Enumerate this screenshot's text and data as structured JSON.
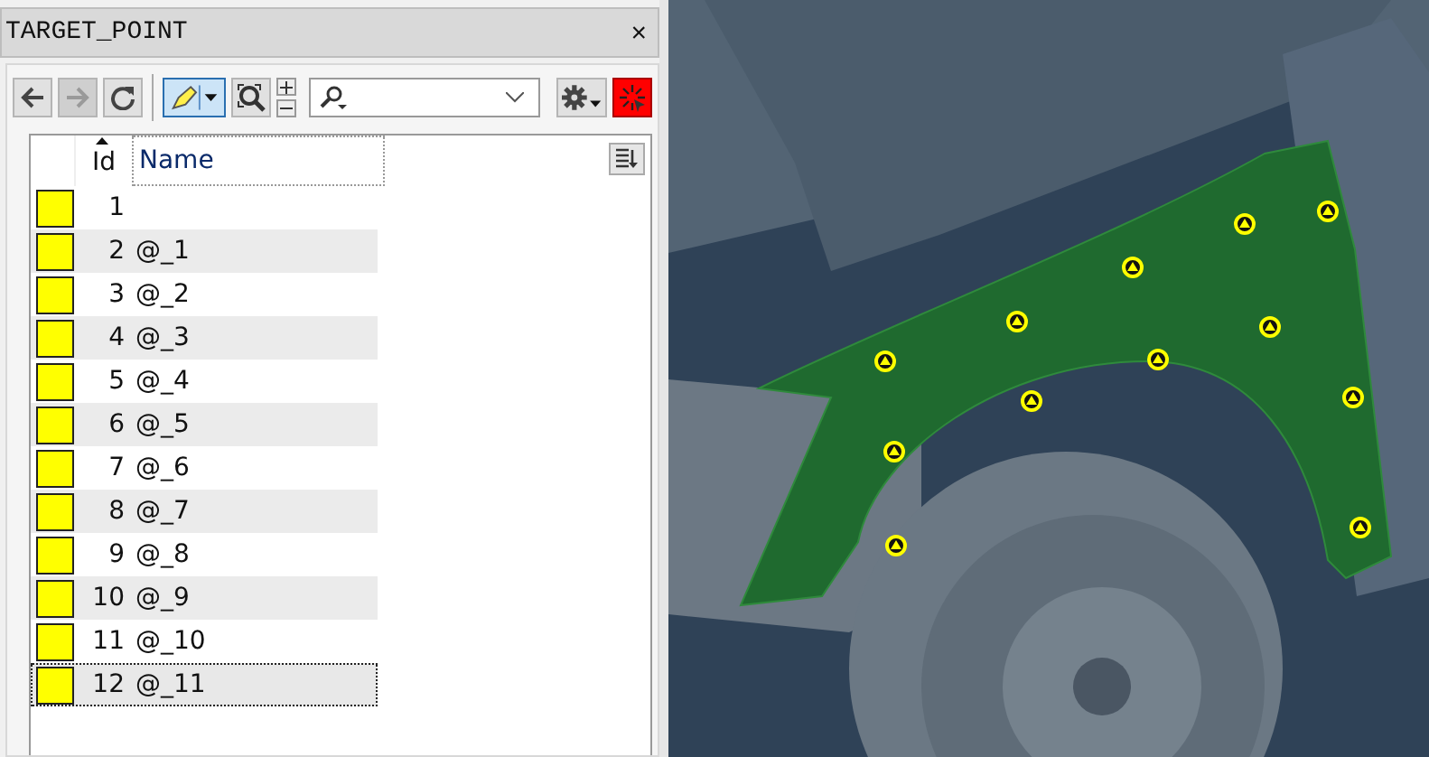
{
  "panel": {
    "title": "TARGET_POINT",
    "close": "×"
  },
  "toolbar": {
    "buttons": [
      {
        "kind": "back",
        "disabled": false
      },
      {
        "kind": "forward",
        "disabled": true
      },
      {
        "kind": "refresh",
        "disabled": false
      }
    ],
    "highlight_pressed": true
  },
  "table": {
    "columns": [
      {
        "label": "Id",
        "sorted": true
      },
      {
        "label": "Name",
        "sorted": false
      }
    ],
    "rows": [
      {
        "number": "1",
        "name": "",
        "color": "#ffff00",
        "selected": false
      },
      {
        "number": "2",
        "name": "@_1",
        "color": "#ffff00",
        "selected": false
      },
      {
        "number": "3",
        "name": "@_2",
        "color": "#ffff00",
        "selected": false
      },
      {
        "number": "4",
        "name": "@_3",
        "color": "#ffff00",
        "selected": false
      },
      {
        "number": "5",
        "name": "@_4",
        "color": "#ffff00",
        "selected": false
      },
      {
        "number": "6",
        "name": "@_5",
        "color": "#ffff00",
        "selected": false
      },
      {
        "number": "7",
        "name": "@_6",
        "color": "#ffff00",
        "selected": false
      },
      {
        "number": "8",
        "name": "@_7",
        "color": "#ffff00",
        "selected": false
      },
      {
        "number": "9",
        "name": "@_8",
        "color": "#ffff00",
        "selected": false
      },
      {
        "number": "10",
        "name": "@_9",
        "color": "#ffff00",
        "selected": false
      },
      {
        "number": "11",
        "name": "@_10",
        "color": "#ffff00",
        "selected": false
      },
      {
        "number": "12",
        "name": "@_11",
        "color": "#ffff00",
        "selected": true
      }
    ]
  }
}
